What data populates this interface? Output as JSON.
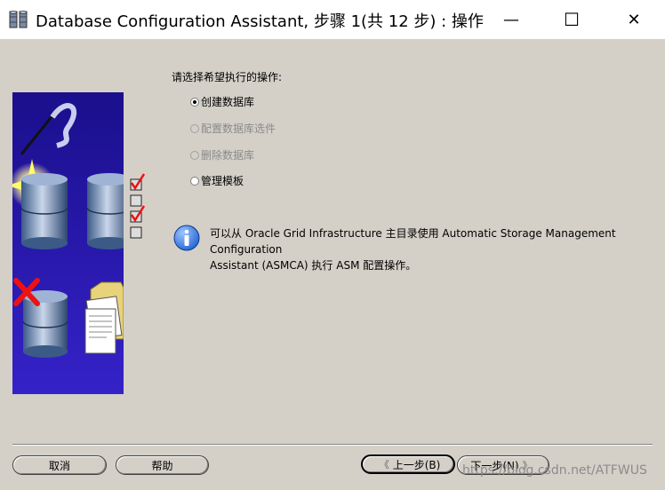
{
  "window": {
    "title": "Database Configuration Assistant, 步骤 1(共 12 步) : 操作",
    "minimize_glyph": "—",
    "maximize_glyph": "☐",
    "close_glyph": "✕"
  },
  "main": {
    "prompt": "请选择希望执行的操作:",
    "options": [
      {
        "label": "创建数据库",
        "selected": true,
        "enabled": true
      },
      {
        "label": "配置数据库选件",
        "selected": false,
        "enabled": false
      },
      {
        "label": "删除数据库",
        "selected": false,
        "enabled": false
      },
      {
        "label": "管理模板",
        "selected": false,
        "enabled": true
      }
    ],
    "info_line1": "可以从 Oracle Grid Infrastructure 主目录使用 Automatic Storage Management Configuration",
    "info_line2": "Assistant (ASMCA) 执行 ASM 配置操作。"
  },
  "footer": {
    "cancel_label": "取消",
    "help_label": "帮助",
    "back_label": "上一步(B)",
    "next_label": "下一步(N)",
    "back_arrow": "《",
    "next_arrow": "》"
  },
  "watermark": "https://blog.csdn.net/ATFWUS",
  "icons": {
    "app": "database-app-icon",
    "info": "info-icon"
  },
  "colors": {
    "panel_bg": "#d4d0c8",
    "side_gradient_top": "#1a0f8c",
    "side_gradient_bottom": "#3522c8",
    "info_blue": "#1f5fd1"
  }
}
